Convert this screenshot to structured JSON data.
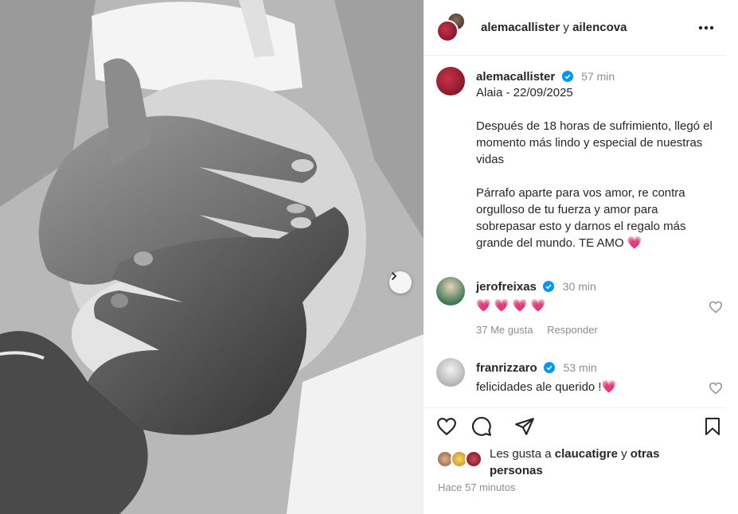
{
  "header": {
    "user1": "alemacallister",
    "joiner": " y ",
    "user2": "ailencova"
  },
  "post": {
    "username": "alemacallister",
    "time": "57 min",
    "caption": "Alaia - 22/09/2025\n\nDespués de 18 horas de sufrimiento, llegó el momento más lindo y especial de nuestras vidas\n\nPárrafo aparte para vos amor, re contra orgulloso de tu fuerza y amor para sobrepasar esto y darnos el regalo más grande del mundo. TE AMO",
    "caption_emoji": "💗"
  },
  "comments": [
    {
      "username": "jerofreixas",
      "time": "30 min",
      "text": "💗 💗 💗 💗",
      "likes": "37 Me gusta",
      "reply": "Responder"
    },
    {
      "username": "franrizzaro",
      "time": "53 min",
      "text": "felicidades ale querido !",
      "text_emoji": "💗"
    }
  ],
  "likes": {
    "prefix": "Les gusta a ",
    "user": "claucatigre",
    "joiner": " y ",
    "suffix": "otras personas"
  },
  "timestamp": "Hace 57 minutos",
  "colors": {
    "verified": "#0095f6",
    "heart": "#ff3a6e",
    "muted": "#8e8e8e"
  },
  "icons": [
    "more-icon",
    "verified-icon",
    "heart-icon",
    "comment-icon",
    "share-icon",
    "bookmark-icon",
    "chevron-right-icon"
  ]
}
